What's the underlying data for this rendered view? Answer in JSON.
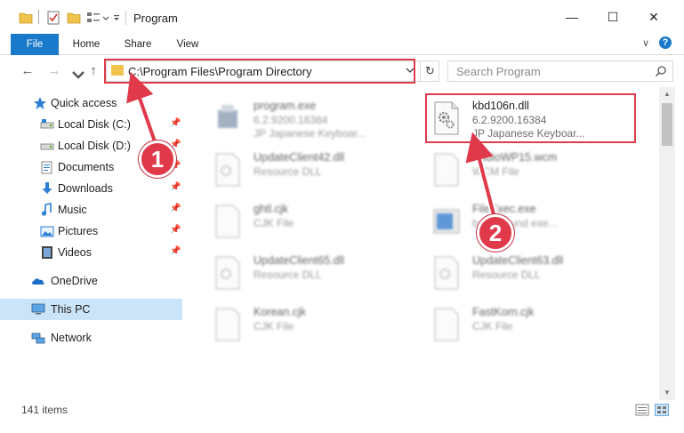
{
  "window": {
    "title": "Program",
    "minimize": "—",
    "maximize": "☐",
    "close": "✕"
  },
  "ribbon": {
    "tabs": [
      "File",
      "Home",
      "Share",
      "View"
    ],
    "help": "?",
    "expand": "∨"
  },
  "address": {
    "path": "C:\\Program Files\\Program Directory",
    "search_placeholder": "Search Program"
  },
  "sidebar": {
    "quick_access": "Quick access",
    "items": [
      {
        "label": "Local Disk (C:)",
        "icon": "drive-icon",
        "pinned": true
      },
      {
        "label": "Local Disk (D:)",
        "icon": "drive-icon",
        "pinned": true
      },
      {
        "label": "Documents",
        "icon": "documents-icon",
        "pinned": true
      },
      {
        "label": "Downloads",
        "icon": "downloads-icon",
        "pinned": true
      },
      {
        "label": "Music",
        "icon": "music-icon",
        "pinned": true
      },
      {
        "label": "Pictures",
        "icon": "pictures-icon",
        "pinned": true
      },
      {
        "label": "Videos",
        "icon": "videos-icon",
        "pinned": true
      }
    ],
    "onedrive": "OneDrive",
    "this_pc": "This PC",
    "network": "Network"
  },
  "files": [
    {
      "name": "program.exe",
      "line2": "6.2.9200.16384",
      "line3": "JP Japanese Keyboar...",
      "blurred": true
    },
    {
      "name": "kbd106n.dll",
      "line2": "6.2.9200.16384",
      "line3": "JP Japanese Keyboar...",
      "blurred": false
    },
    {
      "name": "UpdateClient42.dll",
      "line2": "Resource DLL",
      "blurred": true
    },
    {
      "name": "AudioWP15.wcm",
      "line2": "WCM File",
      "blurred": true
    },
    {
      "name": "ghtl.cjk",
      "line2": "CJK File",
      "blurred": true
    },
    {
      "name": "FileExec.exe",
      "line2": "background exe...",
      "blurred": true
    },
    {
      "name": "UpdateClient65.dll",
      "line2": "Resource DLL",
      "blurred": true
    },
    {
      "name": "UpdateClient63.dll",
      "line2": "Resource DLL",
      "blurred": true
    },
    {
      "name": "Korean.cjk",
      "line2": "CJK File",
      "blurred": true
    },
    {
      "name": "FastKorn.cjk",
      "line2": "CJK File",
      "blurred": true
    }
  ],
  "status": {
    "count": "141 items"
  },
  "annotations": {
    "step1": "1",
    "step2": "2"
  },
  "colors": {
    "accent": "#1979ca",
    "highlight": "#dd3c4a",
    "selected": "#cce4f7"
  }
}
